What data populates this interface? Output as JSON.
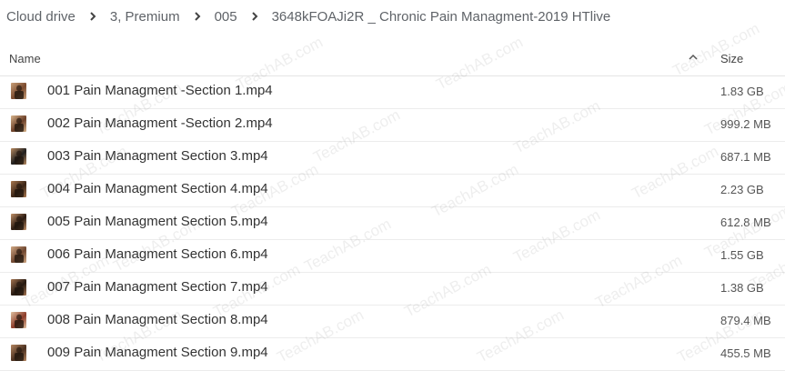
{
  "breadcrumb": {
    "items": [
      "Cloud drive",
      "3, Premium",
      "005",
      "3648kFOAJi2R _ Chronic Pain Managment-2019 HTlive"
    ]
  },
  "table": {
    "name_header": "Name",
    "size_header": "Size",
    "sort_icon": "chevron-up-icon",
    "rows": [
      {
        "name": "001 Pain Managment -Section 1.mp4",
        "size": "1.83 GB",
        "thumb": [
          "#7a4a2e",
          "#c9a07a"
        ]
      },
      {
        "name": "002 Pain Managment -Section 2.mp4",
        "size": "999.2 MB",
        "thumb": [
          "#6b3f28",
          "#d8b48c"
        ]
      },
      {
        "name": "003 Pain Managment Section 3.mp4",
        "size": "687.1 MB",
        "thumb": [
          "#1e1e1e",
          "#b88a60"
        ]
      },
      {
        "name": "004 Pain Managment Section 4.mp4",
        "size": "2.23 GB",
        "thumb": [
          "#3a2516",
          "#a87850"
        ]
      },
      {
        "name": "005 Pain Managment Section 5.mp4",
        "size": "612.8 MB",
        "thumb": [
          "#2a1a10",
          "#c09068"
        ]
      },
      {
        "name": "006 Pain Managment Section 6.mp4",
        "size": "1.55 GB",
        "thumb": [
          "#6e4630",
          "#d0a884"
        ]
      },
      {
        "name": "007 Pain Managment Section 7.mp4",
        "size": "1.38 GB",
        "thumb": [
          "#241810",
          "#a47450"
        ]
      },
      {
        "name": "008 Pain Managment Section 8.mp4",
        "size": "879.4 MB",
        "thumb": [
          "#8c3c2a",
          "#e0c0a0"
        ]
      },
      {
        "name": "009 Pain Managment Section 9.mp4",
        "size": "455.5 MB",
        "thumb": [
          "#4a3020",
          "#b48660"
        ]
      }
    ]
  },
  "watermark": {
    "text": "TeachAB.com"
  }
}
